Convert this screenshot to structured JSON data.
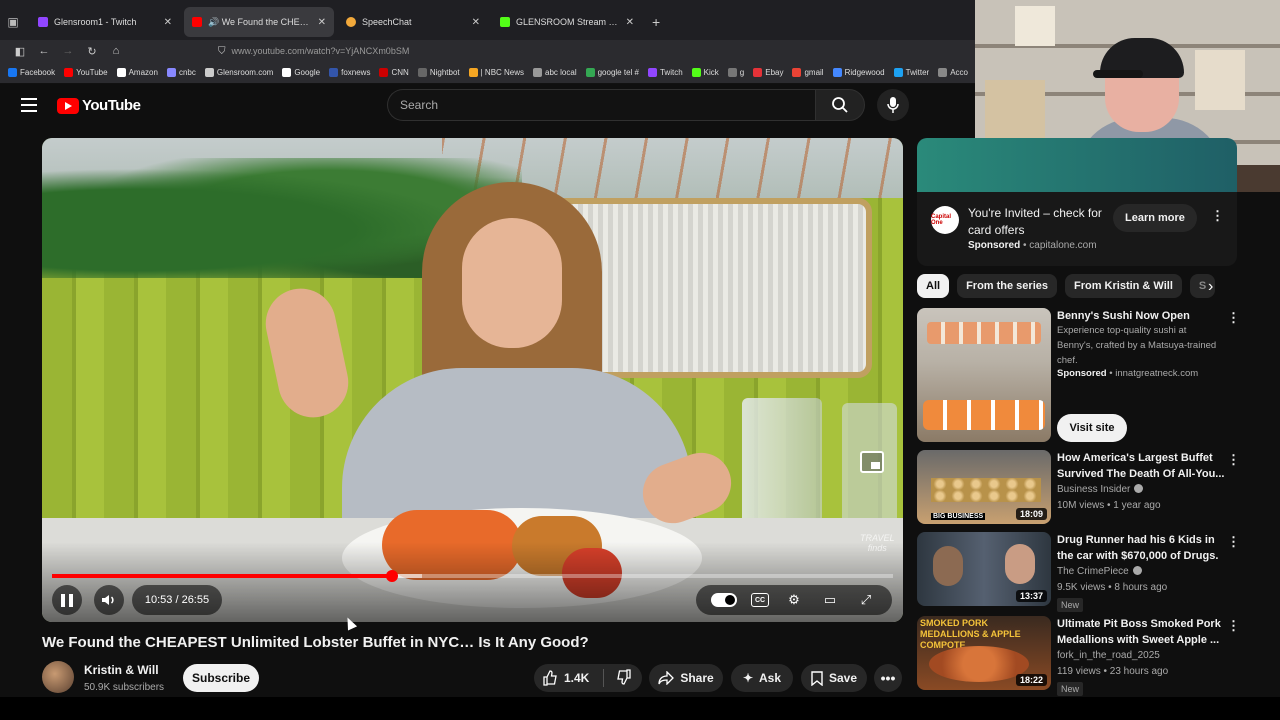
{
  "browser": {
    "tabs": [
      {
        "title": "Glensroom1 - Twitch",
        "favicon_color": "#9146ff",
        "active": false
      },
      {
        "title": "We Found the CHEAPEST U",
        "favicon_color": "#ff0000",
        "active": true
      },
      {
        "title": "SpeechChat",
        "favicon_color": "#f2a93b",
        "active": false
      },
      {
        "title": "GLENSROOM Stream - Watch L",
        "favicon_color": "#53fc18",
        "active": false
      }
    ],
    "new_tab": "+",
    "url": "www.youtube.com/watch?v=YjANCXm0bSM",
    "bookmarks": [
      {
        "label": "Facebook",
        "color": "#1877f2"
      },
      {
        "label": "YouTube",
        "color": "#ff0000"
      },
      {
        "label": "Amazon",
        "color": "#ffffff"
      },
      {
        "label": "cnbc",
        "color": "#8888ff"
      },
      {
        "label": "Glensroom.com",
        "color": "#cccccc"
      },
      {
        "label": "Google",
        "color": "#ffffff"
      },
      {
        "label": "foxnews",
        "color": "#3355aa"
      },
      {
        "label": "CNN",
        "color": "#cc0000"
      },
      {
        "label": "Nightbot",
        "color": "#666666"
      },
      {
        "label": "| NBC News",
        "color": "#f5a623"
      },
      {
        "label": "abc local",
        "color": "#999999"
      },
      {
        "label": "google tel #",
        "color": "#34a853"
      },
      {
        "label": "Twitch",
        "color": "#9146ff"
      },
      {
        "label": "Kick",
        "color": "#53fc18"
      },
      {
        "label": "g",
        "color": "#777777"
      },
      {
        "label": "Ebay",
        "color": "#e53238"
      },
      {
        "label": "gmail",
        "color": "#ea4335"
      },
      {
        "label": "Ridgewood",
        "color": "#4488ff"
      },
      {
        "label": "Twitter",
        "color": "#1da1f2"
      },
      {
        "label": "Acco",
        "color": "#888888"
      }
    ]
  },
  "youtube": {
    "logo_text": "YouTube",
    "search_placeholder": "Search"
  },
  "player": {
    "time_display": "10:53 / 26:55",
    "played_fraction": 0.404,
    "loaded_fraction": 0.44,
    "watermark": "TRAVEL\nfinds"
  },
  "video": {
    "title": "We Found the CHEAPEST Unlimited Lobster Buffet in NYC… Is It Any Good?",
    "channel": "Kristin & Will",
    "subscribers": "50.9K subscribers",
    "subscribe_label": "Subscribe",
    "likes": "1.4K",
    "share_label": "Share",
    "ask_label": "Ask",
    "save_label": "Save"
  },
  "ad": {
    "logo_text": "Capital One",
    "title": "You're Invited – check for card offers",
    "sponsored": "Sponsored",
    "domain": "capitalone.com",
    "cta": "Learn more"
  },
  "chips": [
    "All",
    "From the series",
    "From Kristin & Will",
    "S"
  ],
  "recommendations": [
    {
      "title": "Benny's Sushi Now Open",
      "desc": "Experience top-quality sushi at Benny's, crafted by a Matsuya-trained chef.",
      "sponsored": "Sponsored",
      "domain": "innatgreatneck.com",
      "cta": "Visit site"
    },
    {
      "title": "How America's Largest Buffet Survived The Death Of All-You...",
      "channel": "Business Insider",
      "meta": "10M views • 1 year ago",
      "duration": "18:09",
      "thumb_text": "BIG BUSINESS"
    },
    {
      "title": "Drug Runner had his 6 Kids in the car with $670,000 of Drugs.",
      "channel": "The CrimePiece",
      "meta": "9.5K views • 8 hours ago",
      "duration": "13:37",
      "badge": "New"
    },
    {
      "title": "Ultimate Pit Boss Smoked Pork Medallions with Sweet Apple ...",
      "channel": "fork_in_the_road_2025",
      "meta": "119 views • 23 hours ago",
      "duration": "18:22",
      "badge": "New",
      "thumb_text": "SMOKED PORK MEDALLIONS & APPLE COMPOTE"
    }
  ]
}
